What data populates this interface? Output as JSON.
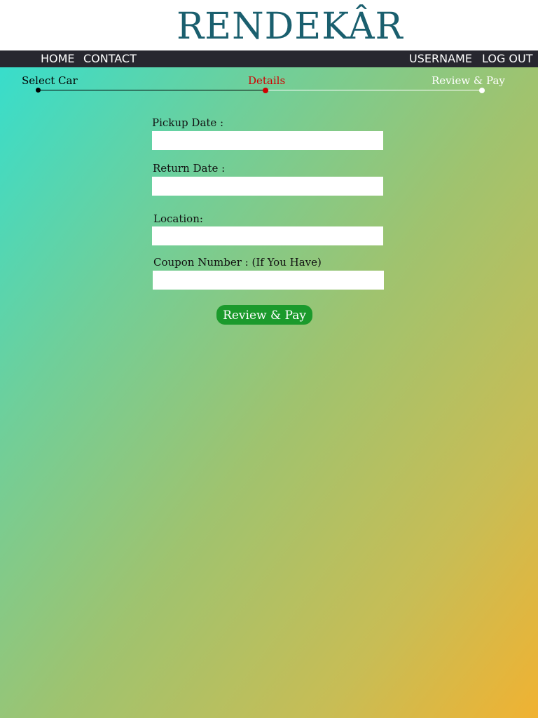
{
  "brand": {
    "logo_text": "RENDEKÂR",
    "logo_color": "#1a5f6e"
  },
  "nav": {
    "home": "HOME",
    "contact": "CONTACT",
    "username": "USERNAME",
    "logout": "LOG OUT"
  },
  "steps": [
    {
      "label": "Select Car",
      "state": "done",
      "color": "#000000"
    },
    {
      "label": "Details",
      "state": "current",
      "color": "#d00000"
    },
    {
      "label": "Review & Pay",
      "state": "upcoming",
      "color": "#ffffff"
    }
  ],
  "form": {
    "pickup_label": "Pickup Date :",
    "pickup_value": "",
    "return_label": "Return Date :",
    "return_value": "",
    "location_label": "Location:",
    "location_value": "",
    "coupon_label": "Coupon Number : (If You Have)",
    "coupon_value": "",
    "submit_label": "Review & Pay"
  },
  "colors": {
    "navbar_bg": "#27272f",
    "button_bg": "#1b9a2c",
    "gradient_start": "#2ee0d4",
    "gradient_end": "#f0b232"
  }
}
